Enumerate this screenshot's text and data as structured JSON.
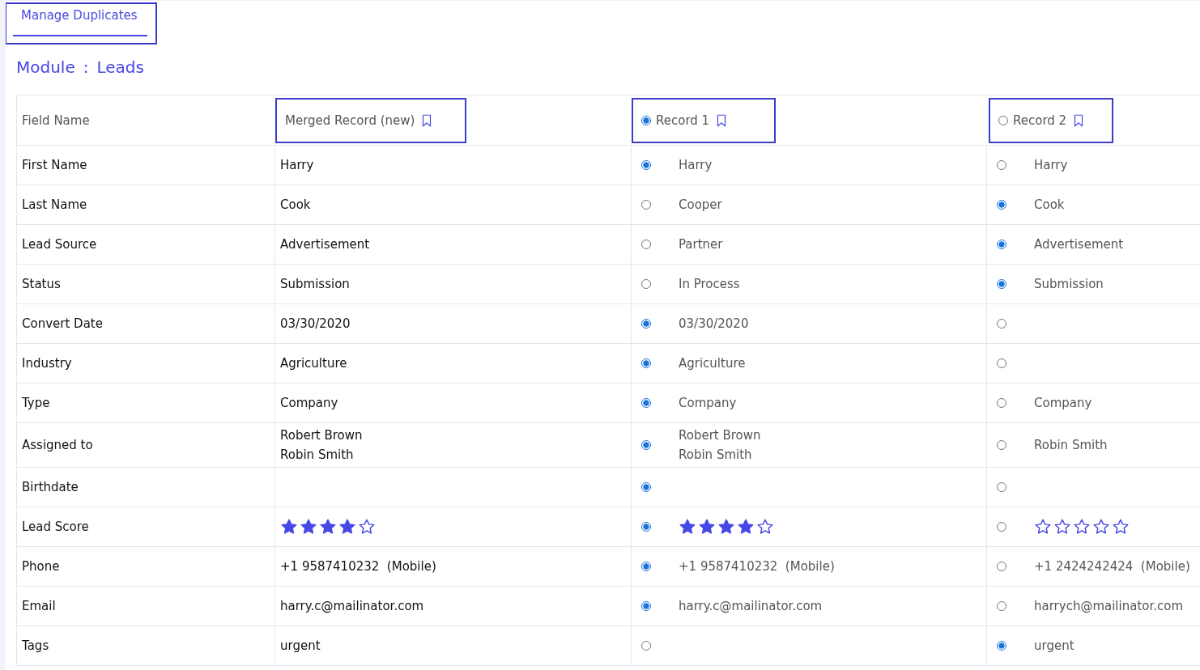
{
  "tab": {
    "label": "Manage Duplicates",
    "selected": true,
    "highlighted": true
  },
  "module": {
    "label": "Module",
    "separator": ":",
    "value": "Leads"
  },
  "table": {
    "columns": [
      {
        "kind": "field",
        "label": "Field Name",
        "highlighted": false
      },
      {
        "kind": "merged",
        "label": "Merged Record (new)",
        "highlighted": true
      },
      {
        "kind": "record",
        "label": "Record 1",
        "selected": true,
        "highlighted": true
      },
      {
        "kind": "record",
        "label": "Record 2",
        "selected": false,
        "highlighted": true
      }
    ],
    "rows": [
      {
        "field": "First Name",
        "merged": {
          "lines": [
            "Harry"
          ]
        },
        "records": [
          {
            "selected": true,
            "lines": [
              "Harry"
            ]
          },
          {
            "selected": false,
            "lines": [
              "Harry"
            ]
          }
        ]
      },
      {
        "field": "Last Name",
        "merged": {
          "lines": [
            "Cook"
          ]
        },
        "records": [
          {
            "selected": false,
            "lines": [
              "Cooper"
            ]
          },
          {
            "selected": true,
            "lines": [
              "Cook"
            ]
          }
        ]
      },
      {
        "field": "Lead Source",
        "merged": {
          "lines": [
            "Advertisement"
          ]
        },
        "records": [
          {
            "selected": false,
            "lines": [
              "Partner"
            ]
          },
          {
            "selected": true,
            "lines": [
              "Advertisement"
            ]
          }
        ]
      },
      {
        "field": "Status",
        "merged": {
          "lines": [
            "Submission"
          ]
        },
        "records": [
          {
            "selected": false,
            "lines": [
              "In Process"
            ]
          },
          {
            "selected": true,
            "lines": [
              "Submission"
            ]
          }
        ]
      },
      {
        "field": "Convert Date",
        "merged": {
          "lines": [
            "03/30/2020"
          ]
        },
        "records": [
          {
            "selected": true,
            "lines": [
              "03/30/2020"
            ]
          },
          {
            "selected": false
          }
        ]
      },
      {
        "field": "Industry",
        "merged": {
          "lines": [
            "Agriculture"
          ]
        },
        "records": [
          {
            "selected": true,
            "lines": [
              "Agriculture"
            ]
          },
          {
            "selected": false
          }
        ]
      },
      {
        "field": "Type",
        "merged": {
          "lines": [
            "Company"
          ]
        },
        "records": [
          {
            "selected": true,
            "lines": [
              "Company"
            ]
          },
          {
            "selected": false,
            "lines": [
              "Company"
            ]
          }
        ]
      },
      {
        "field": "Assigned to",
        "merged": {
          "lines": [
            "Robert Brown",
            "Robin Smith"
          ]
        },
        "records": [
          {
            "selected": true,
            "lines": [
              "Robert Brown",
              "Robin Smith"
            ]
          },
          {
            "selected": false,
            "lines": [
              "Robin Smith"
            ]
          }
        ]
      },
      {
        "field": "Birthdate",
        "records": [
          {
            "selected": true
          },
          {
            "selected": false
          }
        ]
      },
      {
        "field": "Lead Score",
        "merged": {
          "stars": 4
        },
        "records": [
          {
            "selected": true,
            "stars": 4
          },
          {
            "selected": false,
            "stars": 0
          }
        ]
      },
      {
        "field": "Phone",
        "merged": {
          "lines": [
            "+1 9587410232  (Mobile)"
          ]
        },
        "records": [
          {
            "selected": true,
            "lines": [
              "+1 9587410232  (Mobile)"
            ]
          },
          {
            "selected": false,
            "lines": [
              "+1 2424242424  (Mobile)"
            ]
          }
        ]
      },
      {
        "field": "Email",
        "merged": {
          "lines": [
            "harry.c@mailinator.com"
          ]
        },
        "records": [
          {
            "selected": true,
            "lines": [
              "harry.c@mailinator.com"
            ]
          },
          {
            "selected": false,
            "lines": [
              "harrych@mailinator.com"
            ]
          }
        ]
      },
      {
        "field": "Tags",
        "merged": {
          "lines": [
            "urgent"
          ]
        },
        "records": [
          {
            "selected": false
          },
          {
            "selected": true,
            "lines": [
              "urgent"
            ]
          }
        ]
      }
    ]
  }
}
